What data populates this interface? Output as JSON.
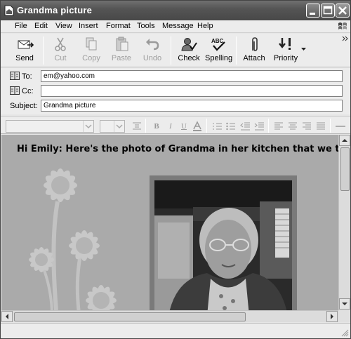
{
  "window": {
    "title": "Grandma picture"
  },
  "menu": [
    "File",
    "Edit",
    "View",
    "Insert",
    "Format",
    "Tools",
    "Message",
    "Help"
  ],
  "toolbar": {
    "send": "Send",
    "cut": "Cut",
    "copy": "Copy",
    "paste": "Paste",
    "undo": "Undo",
    "check": "Check",
    "spelling": "Spelling",
    "attach": "Attach",
    "priority": "Priority"
  },
  "fields": {
    "to_label": "To:",
    "to_value": "em@yahoo.com",
    "cc_label": "Cc:",
    "cc_value": "",
    "subject_label": "Subject:",
    "subject_value": "Grandma picture"
  },
  "body": {
    "greeting": "Hi Emily: Here's the photo of Grandma in her kitchen that we took on vaca"
  },
  "icons": [
    "app-icon",
    "minimize-icon",
    "maximize-icon",
    "close-icon",
    "windows-flag-icon",
    "send-icon",
    "cut-icon",
    "copy-icon",
    "paste-icon",
    "undo-icon",
    "check-icon",
    "spelling-icon",
    "attach-icon",
    "priority-icon",
    "address-book-icon"
  ]
}
